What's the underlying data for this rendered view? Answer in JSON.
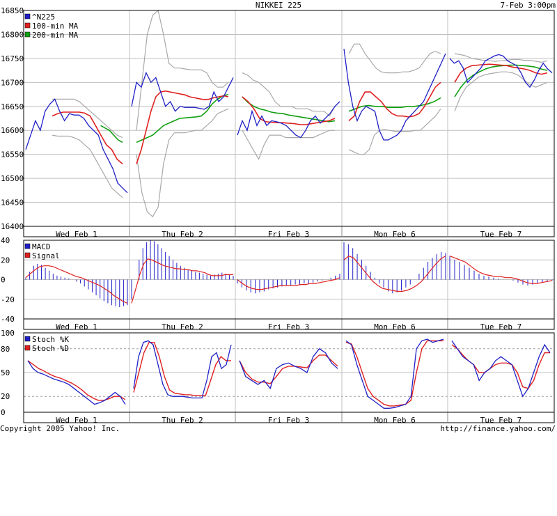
{
  "title": "NIKKEI 225",
  "timestamp": "7-Feb 3:00pm",
  "footer": {
    "copyright": "Copyright 2005 Yahoo! Inc.",
    "url": "http://finance.yahoo.com/"
  },
  "day_labels": [
    "Wed Feb  1",
    "Thu Feb  2",
    "Fri Feb  3",
    "Mon Feb  6",
    "Tue Feb  7"
  ],
  "colors": {
    "price": "#1f1fc8",
    "ma100": "#e02020",
    "ma200": "#10a010",
    "band": "#a8a8a8",
    "macd": "#1f1fc8",
    "signal": "#e02020",
    "stoch_k": "#1f1fc8",
    "stoch_d": "#e02020"
  },
  "chart_data": [
    {
      "type": "line",
      "legend": [
        "^N225",
        "100-min MA",
        "200-min MA"
      ],
      "ylim": [
        16400,
        16850
      ],
      "yticks": [
        16400,
        16450,
        16500,
        16550,
        16600,
        16650,
        16700,
        16750,
        16800,
        16850
      ],
      "days": [
        {
          "day": "Wed Feb  1",
          "price": [
            16560,
            16590,
            16620,
            16600,
            16640,
            16655,
            16665,
            16640,
            16620,
            16635,
            16632,
            16632,
            16625,
            16610,
            16600,
            16590,
            16560,
            16540,
            16520,
            16490,
            16480,
            16470
          ],
          "ma100": [
            null,
            null,
            null,
            null,
            16630,
            16635,
            16638,
            16638,
            16638,
            16638,
            16636,
            16630,
            16610,
            16590,
            16570,
            16560,
            16540,
            16530
          ],
          "ma200": [
            null,
            null,
            null,
            null,
            null,
            null,
            null,
            null,
            null,
            null,
            null,
            null,
            null,
            null,
            null,
            null,
            16610,
            16605,
            16600,
            16590,
            16580,
            16575
          ],
          "upper": [
            null,
            null,
            null,
            null,
            16665,
            16665,
            16665,
            16665,
            16665,
            16660,
            16650,
            16640,
            16630,
            16620,
            16610,
            16600,
            16590,
            16585
          ],
          "lower": [
            null,
            null,
            null,
            null,
            16590,
            16588,
            16588,
            16588,
            16585,
            16580,
            16570,
            16560,
            16540,
            16520,
            16500,
            16480,
            16470,
            16460
          ]
        },
        {
          "day": "Thu Feb  2",
          "price": [
            16650,
            16700,
            16690,
            16720,
            16700,
            16710,
            16680,
            16650,
            16660,
            16640,
            16650,
            16648,
            16648,
            16648,
            16646,
            16644,
            16650,
            16680,
            16660,
            16670,
            16690,
            16710
          ],
          "ma100": [
            16530,
            16560,
            16600,
            16640,
            16670,
            16680,
            16682,
            16680,
            16678,
            16676,
            16674,
            16670,
            16668,
            16666,
            16664,
            16665,
            16668,
            16670,
            16672,
            16670
          ],
          "ma200": [
            16575,
            16580,
            16585,
            16590,
            16600,
            16610,
            16615,
            16620,
            16625,
            16626,
            16627,
            16628,
            16630,
            16640,
            16655,
            16665,
            16672,
            16675
          ],
          "upper": [
            16600,
            16700,
            16800,
            16840,
            16850,
            16800,
            16740,
            16730,
            16730,
            16728,
            16726,
            16726,
            16726,
            16720,
            16700,
            16690,
            16690,
            16700
          ],
          "lower": [
            16550,
            16470,
            16430,
            16420,
            16440,
            16530,
            16580,
            16595,
            16595,
            16595,
            16598,
            16600,
            16600,
            16610,
            16620,
            16635,
            16640,
            16645
          ]
        },
        {
          "day": "Fri Feb  3",
          "price": [
            16590,
            16620,
            16600,
            16640,
            16610,
            16630,
            16610,
            16620,
            16618,
            16615,
            16610,
            16600,
            16590,
            16585,
            16600,
            16620,
            16630,
            16615,
            16625,
            16635,
            16650,
            16660
          ],
          "ma100": [
            16670,
            16660,
            16645,
            16625,
            16618,
            16617,
            16616,
            16616,
            16615,
            16614,
            16612,
            16612,
            16614,
            16616,
            16618,
            16620,
            16625
          ],
          "ma200": [
            16670,
            16658,
            16650,
            16645,
            16642,
            16638,
            16636,
            16635,
            16632,
            16630,
            16628,
            16626,
            16624,
            16622,
            16620,
            16618,
            16620
          ],
          "upper": [
            16720,
            16715,
            16705,
            16700,
            16690,
            16680,
            16660,
            16650,
            16650,
            16650,
            16645,
            16645,
            16645,
            16640,
            16640,
            16640,
            16630,
            16650
          ],
          "lower": [
            16600,
            16580,
            16560,
            16540,
            16570,
            16590,
            16590,
            16590,
            16585,
            16585,
            16585,
            16585,
            16585,
            16585,
            16590,
            16595,
            16600,
            16600
          ]
        },
        {
          "day": "Mon Feb  6",
          "price": [
            16770,
            16700,
            16650,
            16620,
            16640,
            16650,
            16645,
            16640,
            16600,
            16580,
            16580,
            16585,
            16590,
            16600,
            16620,
            16630,
            16640,
            16650,
            16660,
            16680,
            16700,
            16720,
            16740,
            16760
          ],
          "ma100": [
            16620,
            16630,
            16660,
            16680,
            16680,
            16670,
            16660,
            16645,
            16635,
            16630,
            16630,
            16628,
            16630,
            16635,
            16650,
            16670,
            16690,
            16700
          ],
          "ma200": [
            16640,
            16645,
            16650,
            16652,
            16650,
            16650,
            16648,
            16648,
            16648,
            16650,
            16650,
            16652,
            16655,
            16660,
            16668
          ],
          "upper": [
            16760,
            16780,
            16780,
            16760,
            16745,
            16730,
            16722,
            16720,
            16720,
            16720,
            16722,
            16722,
            16725,
            16730,
            16745,
            16760,
            16765,
            16760
          ],
          "lower": [
            16560,
            16555,
            16550,
            16550,
            16560,
            16590,
            16600,
            16602,
            16600,
            16598,
            16598,
            16598,
            16598,
            16600,
            16600,
            16610,
            16620,
            16630,
            16645
          ]
        },
        {
          "day": "Tue Feb  7",
          "price": [
            16750,
            16740,
            16745,
            16730,
            16700,
            16710,
            16720,
            16730,
            16745,
            16750,
            16755,
            16758,
            16755,
            16745,
            16740,
            16735,
            16720,
            16700,
            16690,
            16705,
            16725,
            16740,
            16728,
            16720
          ],
          "ma100": [
            16700,
            16720,
            16730,
            16735,
            16736,
            16737,
            16738,
            16737,
            16736,
            16735,
            16732,
            16730,
            16728,
            16725,
            16720,
            16717,
            16720
          ],
          "ma200": [
            16670,
            16690,
            16705,
            16715,
            16722,
            16728,
            16732,
            16734,
            16735,
            16736,
            16736,
            16735,
            16734,
            16732,
            16728,
            16725
          ],
          "upper": [
            16760,
            16758,
            16755,
            16750,
            16748,
            16746,
            16745,
            16744,
            16745,
            16746,
            16748,
            16748,
            16746,
            16746,
            16744,
            16742,
            16745
          ],
          "lower": [
            16640,
            16670,
            16690,
            16700,
            16710,
            16715,
            16718,
            16720,
            16722,
            16722,
            16720,
            16715,
            16705,
            16695,
            16690,
            16695,
            16700
          ]
        }
      ]
    },
    {
      "type": "bar",
      "legend": [
        "MACD",
        "Signal"
      ],
      "ylim": [
        -40,
        40
      ],
      "yticks": [
        -40,
        -20,
        0,
        20,
        40
      ],
      "days": [
        {
          "day": "Wed Feb  1",
          "macd": [
            2,
            8,
            14,
            16,
            15,
            12,
            9,
            6,
            4,
            3,
            2,
            1,
            0,
            -2,
            -4,
            -7,
            -10,
            -13,
            -16,
            -19,
            -22,
            -24,
            -26,
            -27,
            -28,
            -27,
            -26
          ],
          "signal": [
            2,
            6,
            10,
            13,
            14,
            14,
            13,
            11,
            9,
            7,
            5,
            3,
            2,
            0,
            -2,
            -4,
            -6,
            -9,
            -12,
            -16,
            -19,
            -22,
            -24
          ]
        },
        {
          "day": "Thu Feb  2",
          "macd": [
            -20,
            0,
            20,
            32,
            38,
            40,
            39,
            36,
            32,
            28,
            24,
            20,
            17,
            14,
            12,
            10,
            9,
            8,
            7,
            6,
            5,
            4,
            5,
            6,
            7,
            6,
            5,
            4
          ],
          "signal": [
            -24,
            -10,
            5,
            16,
            21,
            20,
            18,
            16,
            14,
            13,
            12,
            11,
            11,
            10,
            10,
            9,
            9,
            8,
            7,
            5,
            4,
            4,
            4,
            5,
            5,
            5
          ]
        },
        {
          "day": "Fri Feb  3",
          "macd": [
            -4,
            -8,
            -11,
            -13,
            -14,
            -13,
            -12,
            -10,
            -9,
            -8,
            -7,
            -6,
            -6,
            -5,
            -5,
            -4,
            -4,
            -3,
            -2,
            -1,
            0,
            2,
            4,
            6
          ],
          "signal": [
            0,
            -4,
            -7,
            -9,
            -10,
            -10,
            -9,
            -8,
            -7,
            -6,
            -6,
            -6,
            -6,
            -5,
            -5,
            -4,
            -4,
            -3,
            -2,
            -1,
            0,
            2
          ]
        },
        {
          "day": "Mon Feb  6",
          "macd": [
            38,
            36,
            32,
            26,
            20,
            14,
            8,
            2,
            -4,
            -8,
            -12,
            -14,
            -13,
            -11,
            -8,
            -5,
            0,
            6,
            12,
            18,
            22,
            26,
            28,
            27
          ],
          "signal": [
            20,
            24,
            22,
            16,
            10,
            4,
            -2,
            -6,
            -9,
            -10,
            -11,
            -12,
            -12,
            -11,
            -9,
            -6,
            -2,
            4,
            10,
            16,
            21,
            24
          ]
        },
        {
          "day": "Tue Feb  7",
          "macd": [
            24,
            20,
            18,
            15,
            12,
            9,
            6,
            4,
            3,
            2,
            1,
            0,
            0,
            -1,
            -3,
            -5,
            -6,
            -5,
            -4,
            -3,
            -2,
            -1
          ],
          "signal": [
            24,
            22,
            20,
            18,
            14,
            10,
            7,
            5,
            4,
            3,
            3,
            2,
            2,
            1,
            -1,
            -3,
            -4,
            -4,
            -3,
            -2,
            -1
          ]
        }
      ]
    },
    {
      "type": "line",
      "legend": [
        "Stoch %K",
        "Stoch %D"
      ],
      "ylim": [
        0,
        100
      ],
      "yticks": [
        0,
        20,
        50,
        80,
        100
      ],
      "days": [
        {
          "day": "Wed Feb  1",
          "k": [
            65,
            55,
            50,
            48,
            45,
            42,
            40,
            38,
            35,
            30,
            25,
            20,
            15,
            10,
            12,
            15,
            20,
            25,
            20,
            10
          ],
          "d": [
            65,
            60,
            55,
            52,
            48,
            45,
            43,
            40,
            37,
            33,
            28,
            22,
            18,
            15,
            15,
            17,
            20,
            20,
            16
          ]
        },
        {
          "day": "Thu Feb  2",
          "k": [
            30,
            70,
            88,
            90,
            85,
            60,
            35,
            22,
            20,
            20,
            20,
            19,
            18,
            18,
            18,
            40,
            70,
            75,
            55,
            60,
            85
          ],
          "d": [
            25,
            50,
            75,
            88,
            88,
            70,
            45,
            28,
            24,
            23,
            22,
            22,
            21,
            21,
            21,
            40,
            60,
            70,
            65,
            65
          ]
        },
        {
          "day": "Fri Feb  3",
          "k": [
            65,
            45,
            40,
            35,
            40,
            30,
            55,
            60,
            62,
            58,
            55,
            50,
            70,
            80,
            75,
            62,
            55
          ],
          "d": [
            65,
            50,
            42,
            38,
            38,
            36,
            45,
            55,
            58,
            58,
            57,
            56,
            65,
            72,
            72,
            65,
            58
          ]
        },
        {
          "day": "Mon Feb  6",
          "k": [
            90,
            85,
            60,
            40,
            20,
            15,
            10,
            5,
            5,
            6,
            8,
            10,
            20,
            80,
            90,
            92,
            88,
            90,
            92
          ],
          "d": [
            88,
            86,
            70,
            50,
            30,
            20,
            15,
            10,
            8,
            8,
            9,
            10,
            15,
            50,
            80,
            90,
            90,
            90,
            90
          ]
        },
        {
          "day": "Tue Feb  7",
          "k": [
            90,
            80,
            70,
            65,
            60,
            40,
            50,
            55,
            65,
            70,
            65,
            60,
            40,
            20,
            30,
            50,
            70,
            85,
            75
          ],
          "d": [
            85,
            80,
            72,
            65,
            60,
            50,
            50,
            55,
            60,
            62,
            62,
            60,
            50,
            32,
            30,
            40,
            60,
            75,
            75
          ]
        }
      ]
    }
  ]
}
